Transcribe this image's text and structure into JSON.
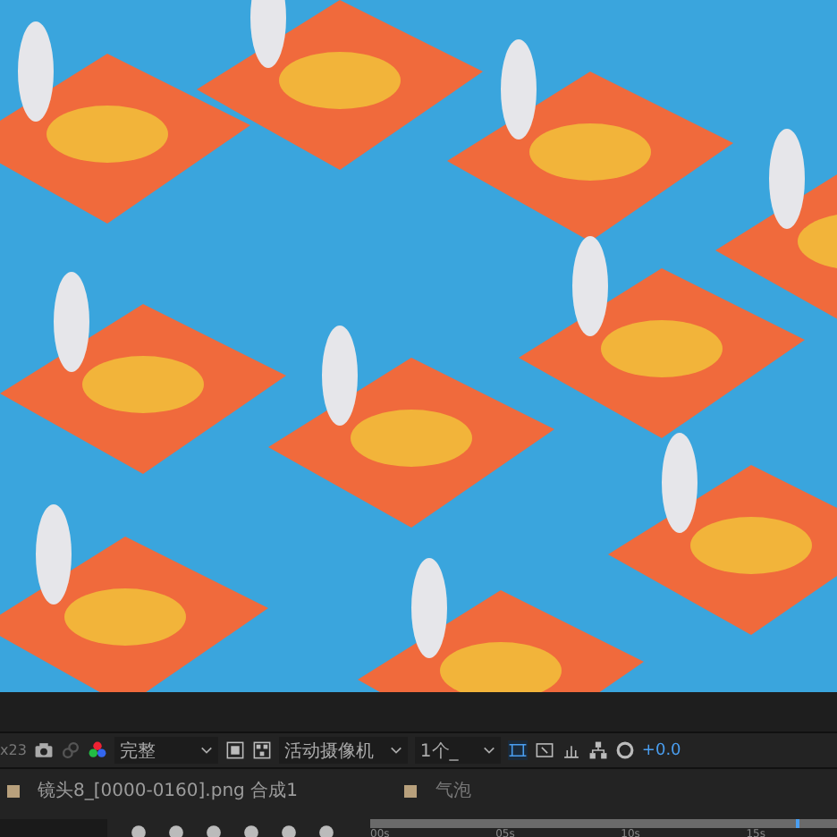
{
  "toolbar": {
    "zoom_readout": "x23",
    "resolution": "完整",
    "camera": "活动摄像机",
    "views": "1个_",
    "exposure": "+0.0"
  },
  "tabs": [
    {
      "label": "镜头8_[0000-0160].png 合成1",
      "color": "#b8a07c",
      "selected": true
    },
    {
      "label": "气泡",
      "color": "#b8a07c",
      "selected": false
    }
  ],
  "timeline": {
    "ticks": [
      "00s",
      "05s",
      "10s",
      "15s"
    ],
    "level": 0.92
  }
}
